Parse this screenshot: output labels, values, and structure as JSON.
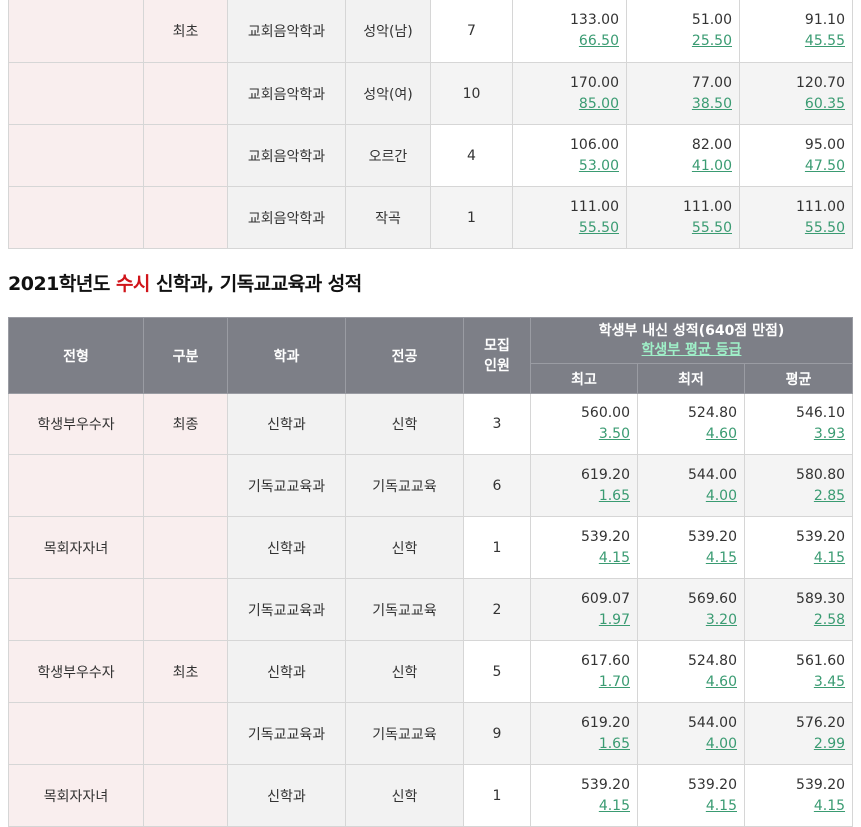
{
  "top_rows": [
    {
      "type": "",
      "division": "최초",
      "dept": "교회음악학과",
      "major": "성악(남)",
      "count": "7",
      "max": {
        "s": "133.00",
        "g": "66.50"
      },
      "min": {
        "s": "51.00",
        "g": "25.50"
      },
      "avg": {
        "s": "91.10",
        "g": "45.55"
      }
    },
    {
      "type": "",
      "division": "",
      "dept": "교회음악학과",
      "major": "성악(여)",
      "count": "10",
      "max": {
        "s": "170.00",
        "g": "85.00"
      },
      "min": {
        "s": "77.00",
        "g": "38.50"
      },
      "avg": {
        "s": "120.70",
        "g": "60.35"
      }
    },
    {
      "type": "",
      "division": "",
      "dept": "교회음악학과",
      "major": "오르간",
      "count": "4",
      "max": {
        "s": "106.00",
        "g": "53.00"
      },
      "min": {
        "s": "82.00",
        "g": "41.00"
      },
      "avg": {
        "s": "95.00",
        "g": "47.50"
      }
    },
    {
      "type": "",
      "division": "",
      "dept": "교회음악학과",
      "major": "작곡",
      "count": "1",
      "max": {
        "s": "111.00",
        "g": "55.50"
      },
      "min": {
        "s": "111.00",
        "g": "55.50"
      },
      "avg": {
        "s": "111.00",
        "g": "55.50"
      }
    }
  ],
  "section": {
    "title_prefix": "2021학년도 ",
    "title_highlight": "수시",
    "title_suffix": " 신학과, 기독교교육과 성적"
  },
  "header": {
    "type": "전형",
    "division": "구분",
    "dept": "학과",
    "major": "전공",
    "count": "모집\n인원",
    "score_title": "학생부 내신 성적(640점 만점)",
    "score_sub": "학생부 평균 등급",
    "max": "최고",
    "min": "최저",
    "avg": "평균"
  },
  "rows": [
    {
      "type": "학생부우수자",
      "division": "최종",
      "dept": "신학과",
      "major": "신학",
      "count": "3",
      "max": {
        "s": "560.00",
        "g": "3.50"
      },
      "min": {
        "s": "524.80",
        "g": "4.60"
      },
      "avg": {
        "s": "546.10",
        "g": "3.93"
      }
    },
    {
      "type": "",
      "division": "",
      "dept": "기독교교육과",
      "major": "기독교교육",
      "count": "6",
      "max": {
        "s": "619.20",
        "g": "1.65"
      },
      "min": {
        "s": "544.00",
        "g": "4.00"
      },
      "avg": {
        "s": "580.80",
        "g": "2.85"
      }
    },
    {
      "type": "목회자자녀",
      "division": "",
      "dept": "신학과",
      "major": "신학",
      "count": "1",
      "max": {
        "s": "539.20",
        "g": "4.15"
      },
      "min": {
        "s": "539.20",
        "g": "4.15"
      },
      "avg": {
        "s": "539.20",
        "g": "4.15"
      }
    },
    {
      "type": "",
      "division": "",
      "dept": "기독교교육과",
      "major": "기독교교육",
      "count": "2",
      "max": {
        "s": "609.07",
        "g": "1.97"
      },
      "min": {
        "s": "569.60",
        "g": "3.20"
      },
      "avg": {
        "s": "589.30",
        "g": "2.58"
      }
    },
    {
      "type": "학생부우수자",
      "division": "최초",
      "dept": "신학과",
      "major": "신학",
      "count": "5",
      "max": {
        "s": "617.60",
        "g": "1.70"
      },
      "min": {
        "s": "524.80",
        "g": "4.60"
      },
      "avg": {
        "s": "561.60",
        "g": "3.45"
      }
    },
    {
      "type": "",
      "division": "",
      "dept": "기독교교육과",
      "major": "기독교교육",
      "count": "9",
      "max": {
        "s": "619.20",
        "g": "1.65"
      },
      "min": {
        "s": "544.00",
        "g": "4.00"
      },
      "avg": {
        "s": "576.20",
        "g": "2.99"
      }
    },
    {
      "type": "목회자자녀",
      "division": "",
      "dept": "신학과",
      "major": "신학",
      "count": "1",
      "max": {
        "s": "539.20",
        "g": "4.15"
      },
      "min": {
        "s": "539.20",
        "g": "4.15"
      },
      "avg": {
        "s": "539.20",
        "g": "4.15"
      }
    }
  ]
}
